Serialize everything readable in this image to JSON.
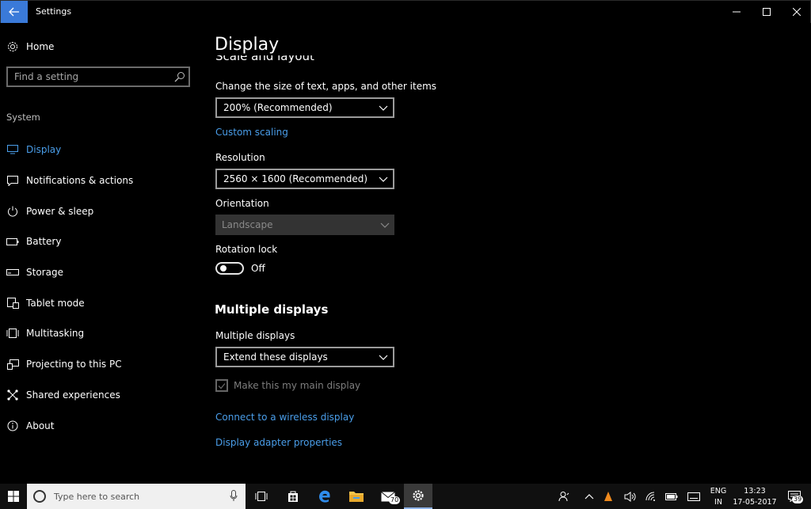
{
  "window": {
    "title": "Settings",
    "back_icon": "arrow-left-icon",
    "minimize_icon": "minimize-icon",
    "maximize_icon": "maximize-icon",
    "close_icon": "close-icon"
  },
  "sidebar": {
    "home_label": "Home",
    "search_placeholder": "Find a setting",
    "section_label": "System",
    "items": [
      {
        "label": "Display",
        "icon": "monitor-icon",
        "active": true
      },
      {
        "label": "Notifications & actions",
        "icon": "message-icon"
      },
      {
        "label": "Power & sleep",
        "icon": "power-icon"
      },
      {
        "label": "Battery",
        "icon": "battery-icon"
      },
      {
        "label": "Storage",
        "icon": "storage-icon"
      },
      {
        "label": "Tablet mode",
        "icon": "tablet-icon"
      },
      {
        "label": "Multitasking",
        "icon": "multitasking-icon"
      },
      {
        "label": "Projecting to this PC",
        "icon": "projecting-icon"
      },
      {
        "label": "Shared experiences",
        "icon": "shared-icon"
      },
      {
        "label": "About",
        "icon": "info-icon"
      }
    ]
  },
  "main": {
    "page_title": "Display",
    "clipped_heading": "Scale and layout",
    "scale_label": "Change the size of text, apps, and other items",
    "scale_value": "200% (Recommended)",
    "custom_scaling_link": "Custom scaling",
    "resolution_label": "Resolution",
    "resolution_value": "2560 × 1600 (Recommended)",
    "orientation_label": "Orientation",
    "orientation_value": "Landscape",
    "rotation_lock_label": "Rotation lock",
    "rotation_lock_state": "Off",
    "multiple_displays_heading": "Multiple displays",
    "multiple_displays_label": "Multiple displays",
    "multiple_displays_value": "Extend these displays",
    "main_display_checkbox": "Make this my main display",
    "wireless_link": "Connect to a wireless display",
    "adapter_link": "Display adapter properties"
  },
  "taskbar": {
    "search_placeholder": "Type here to search",
    "mail_badge": "70",
    "language": "ENG",
    "region": "IN",
    "time": "13:23",
    "date": "17-05-2017",
    "notification_count": "39"
  }
}
